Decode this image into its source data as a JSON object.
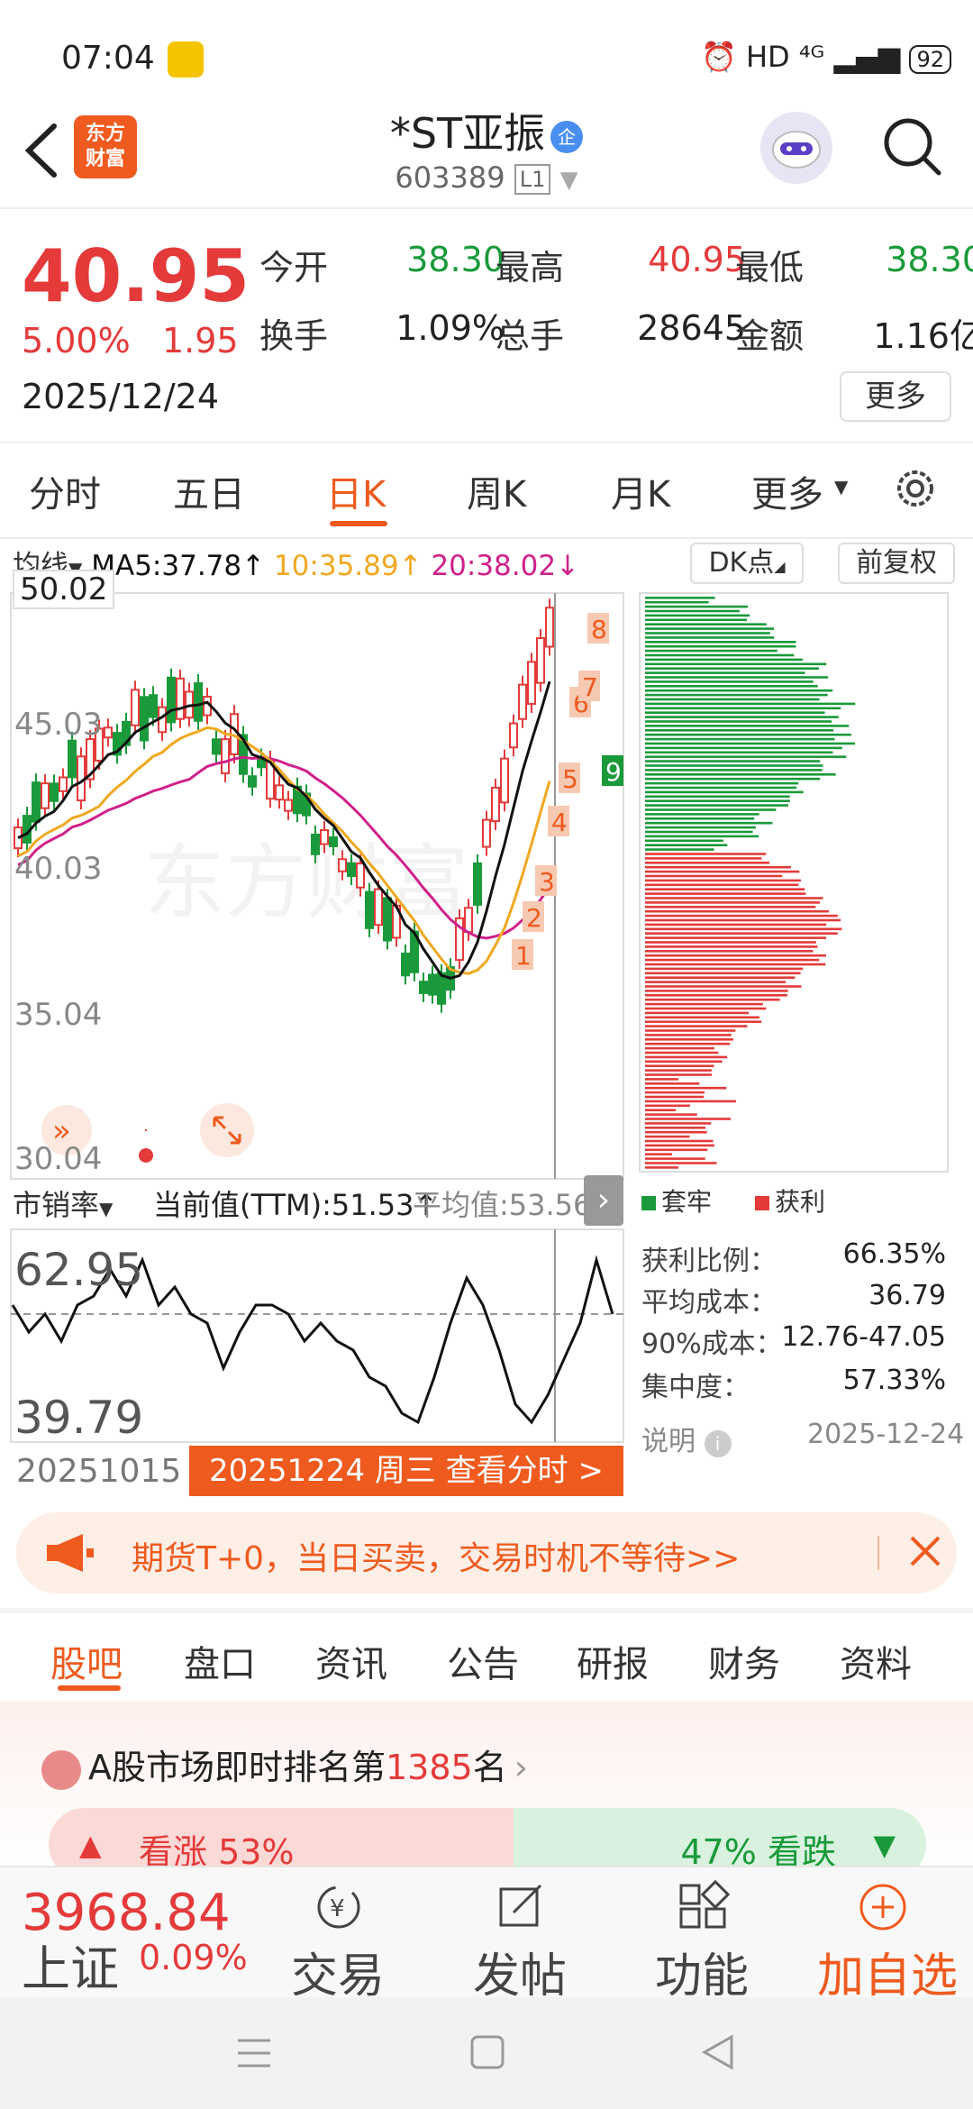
{
  "status_bar": {
    "time": "07:04",
    "indicators": "HD ⁴ᴳ",
    "battery": "92"
  },
  "header": {
    "back_icon": "chevron-left-icon",
    "logo_text": "东方\n财富",
    "stock_name": "*ST亚振",
    "entity_badge": "企",
    "stock_code": "603389",
    "level_badge": "L1",
    "robot_icon": "robot-avatar-icon",
    "search_icon": "search-icon"
  },
  "quote": {
    "price": "40.95",
    "change_pct": "5.00%",
    "change": "1.95",
    "date": "2025/12/24",
    "stats": [
      {
        "label": "今开",
        "value": "38.30",
        "color": "green"
      },
      {
        "label": "最高",
        "value": "40.95",
        "color": "red"
      },
      {
        "label": "最低",
        "value": "38.30",
        "color": "green"
      },
      {
        "label": "换手",
        "value": "1.09%",
        "color": "black"
      },
      {
        "label": "总手",
        "value": "28645",
        "color": "black"
      },
      {
        "label": "金额",
        "value": "1.16亿",
        "color": "black"
      }
    ],
    "more_label": "更多"
  },
  "period_tabs": [
    "分时",
    "五日",
    "日K",
    "周K",
    "月K",
    "更多"
  ],
  "active_period": "日K",
  "ma_legend": {
    "selector": "均线",
    "ma5": "MA5:37.78↑",
    "ma10": "10:35.89↑",
    "ma20": "20:38.02↓",
    "dk_label": "DK点",
    "adjust_label": "前复权",
    "crosshair_value": "50.02"
  },
  "kline_axis": [
    "50.02",
    "45.03",
    "40.03",
    "35.04",
    "30.04"
  ],
  "markers": [
    "1",
    "2",
    "3",
    "4",
    "5",
    "6",
    "7",
    "8",
    "9"
  ],
  "cost_distribution": {
    "legend_hold": "套牢",
    "legend_profit": "获利",
    "rows": [
      {
        "label": "获利比例：",
        "value": "66.35%"
      },
      {
        "label": "平均成本：",
        "value": "36.79"
      },
      {
        "label": "90%成本：",
        "value": "12.76-47.05"
      },
      {
        "label": "集中度：",
        "value": "57.33%"
      }
    ],
    "note_label": "说明",
    "note_date": "2025-12-24"
  },
  "indicator": {
    "name": "市销率",
    "current": "当前值(TTM):51.53↑",
    "average": "平均值:53.56",
    "high": "62.95",
    "low": "39.79",
    "start_date": "20251015",
    "tip": "20251224 周三 查看分时 >"
  },
  "banner": {
    "text": "期货T+0，当日买卖，交易时机不等待>>"
  },
  "content_tabs": [
    "股吧",
    "盘口",
    "资讯",
    "公告",
    "研报",
    "财务",
    "资料"
  ],
  "active_content_tab": "股吧",
  "rank": {
    "prefix": "A股市场即时排名第",
    "number": "1385",
    "suffix": "名"
  },
  "vote": {
    "up": "看涨 53%",
    "down": "47% 看跌",
    "up_fraction": 0.53
  },
  "bottom_nav": {
    "index_value": "3968.84",
    "index_name": "上证",
    "index_pct": "0.09%",
    "items": [
      "交易",
      "发帖",
      "功能",
      "加自选"
    ]
  },
  "colors": {
    "accent": "#ef5a1e",
    "up": "#e43a3a",
    "down": "#1a9a3a",
    "ma5": "#111111",
    "ma10": "#f0a820",
    "ma20": "#d0208a"
  }
}
